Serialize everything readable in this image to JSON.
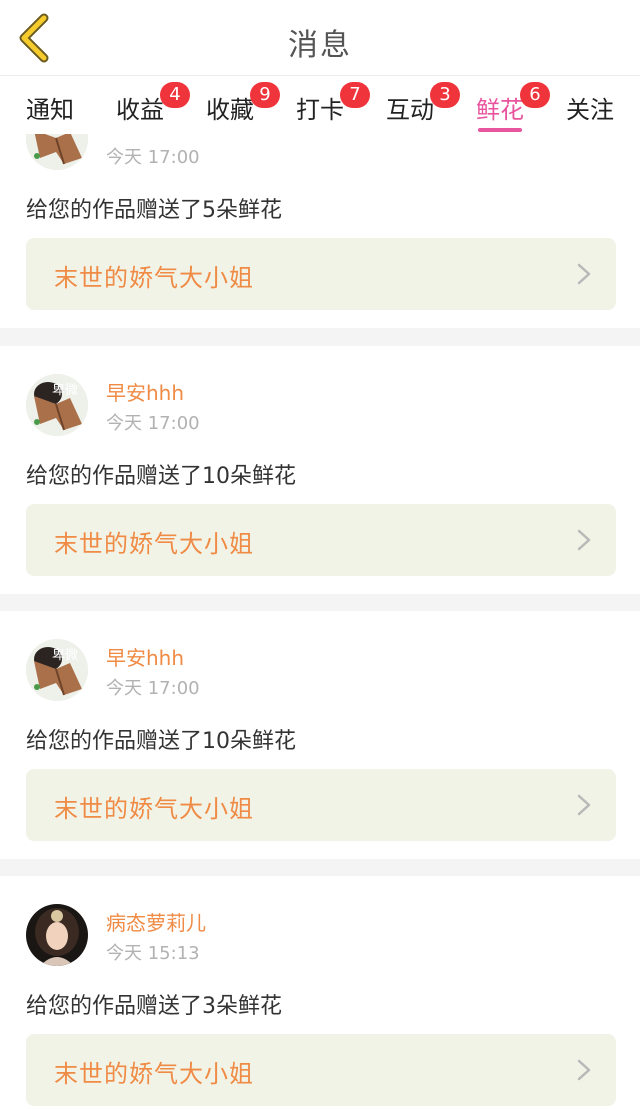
{
  "header": {
    "title": "消息"
  },
  "tabs": [
    {
      "label": "通知",
      "badge": ""
    },
    {
      "label": "收益",
      "badge": "4"
    },
    {
      "label": "收藏",
      "badge": "9"
    },
    {
      "label": "打卡",
      "badge": "7"
    },
    {
      "label": "互动",
      "badge": "3"
    },
    {
      "label": "鲜花",
      "badge": "6"
    },
    {
      "label": "关注",
      "badge": ""
    }
  ],
  "active_tab": "鲜花",
  "colors": {
    "accent_pink": "#e9549e",
    "name_orange": "#ef8b45",
    "badge_red": "#f0343c",
    "work_bg": "#f2f3e7"
  },
  "notifications": [
    {
      "user": "",
      "time": "今天 17:00",
      "message": "给您的作品赠送了5朵鲜花",
      "work_title": "末世的娇气大小姐",
      "avatar": "cartoon-sign-avatar"
    },
    {
      "user": "早安hhh",
      "time": "今天 17:00",
      "message": "给您的作品赠送了10朵鲜花",
      "work_title": "末世的娇气大小姐",
      "avatar": "cartoon-sign-avatar"
    },
    {
      "user": "早安hhh",
      "time": "今天 17:00",
      "message": "给您的作品赠送了10朵鲜花",
      "work_title": "末世的娇气大小姐",
      "avatar": "cartoon-sign-avatar"
    },
    {
      "user": "病态萝莉儿",
      "time": "今天 15:13",
      "message": "给您的作品赠送了3朵鲜花",
      "work_title": "末世的娇气大小姐",
      "avatar": "girl-portrait-avatar"
    }
  ],
  "avatar_text": "卑微"
}
